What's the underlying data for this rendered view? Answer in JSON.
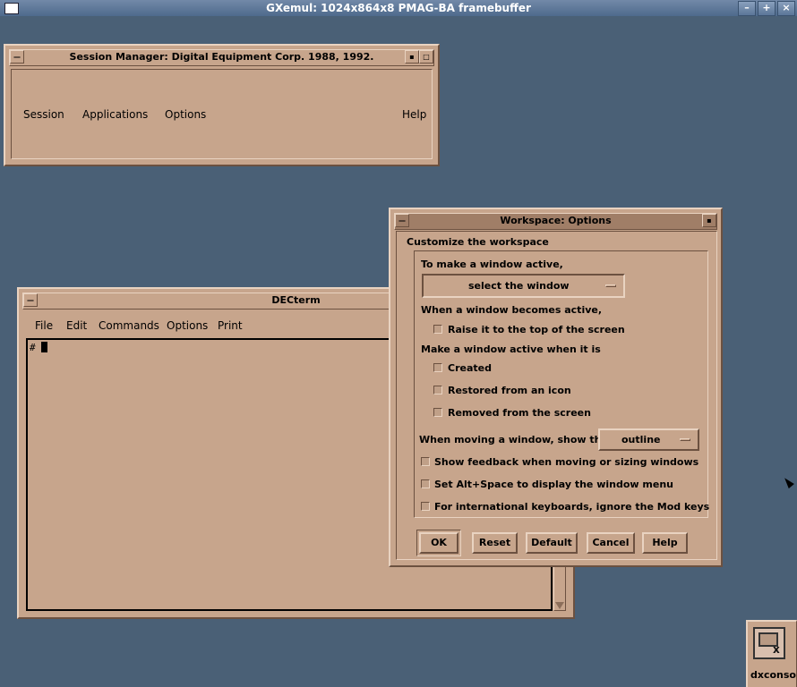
{
  "host": {
    "title": "GXemul: 1024x864x8 PMAG-BA framebuffer",
    "controls": [
      "–",
      "+",
      "×"
    ]
  },
  "session_manager": {
    "title": "Session Manager:   Digital Equipment Corp. 1988, 1992.",
    "menu": {
      "session": "Session",
      "applications": "Applications",
      "options": "Options",
      "help": "Help"
    }
  },
  "decterm": {
    "title": "DECterm",
    "menu": {
      "file": "File",
      "edit": "Edit",
      "commands": "Commands",
      "options": "Options",
      "print": "Print"
    },
    "prompt": "#"
  },
  "workspace_options": {
    "title": "Workspace: Options",
    "heading": "Customize the workspace",
    "make_active_label": "To make a window active,",
    "make_active_value": "select the window",
    "becomes_active_label": "When a window becomes active,",
    "raise_label": "Raise it to the top of the screen",
    "active_when_label": "Make a window active when it is",
    "created_label": "Created",
    "restored_label": "Restored from an icon",
    "removed_label": "Removed from the screen",
    "moving_label": "When moving a window, show the",
    "moving_value": "outline",
    "feedback_label": "Show feedback when moving or sizing windows",
    "altspace_label": "Set Alt+Space to display the window menu",
    "intl_label": "For international keyboards, ignore the Mod keys",
    "buttons": {
      "ok": "OK",
      "reset": "Reset",
      "default": "Default",
      "cancel": "Cancel",
      "help": "Help"
    }
  },
  "icon": {
    "label": "dxconso"
  }
}
